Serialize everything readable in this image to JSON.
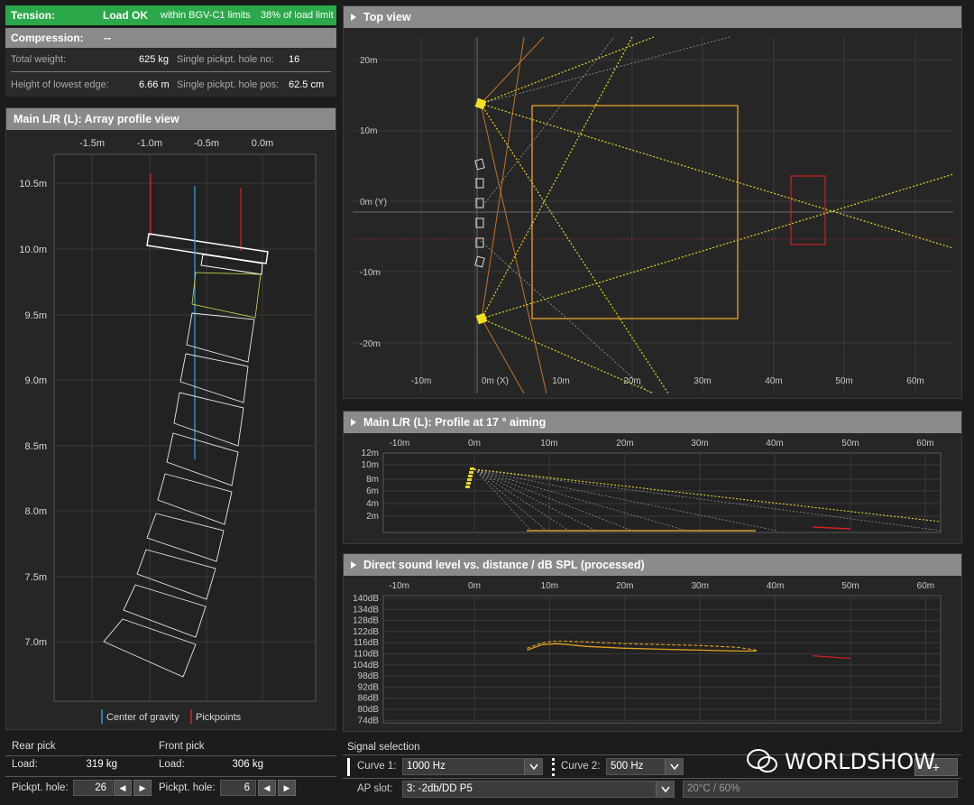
{
  "status": {
    "tension_label": "Tension:",
    "tension_state": "Load OK",
    "tension_limit_text": "within BGV-C1 limits",
    "tension_percent_text": "38% of load limit",
    "compression_label": "Compression:",
    "compression_value": "--",
    "total_weight_label": "Total weight:",
    "total_weight_value": "625 kg",
    "pickpt_hole_no_label": "Single pickpt. hole no:",
    "pickpt_hole_no_value": "16",
    "lowest_edge_label": "Height of lowest edge:",
    "lowest_edge_value": "6.66 m",
    "pickpt_hole_pos_label": "Single pickpt. hole pos:",
    "pickpt_hole_pos_value": "62.5 cm",
    "ok_color": "#2aa84a"
  },
  "array_profile": {
    "title": "Main L/R (L): Array profile view",
    "x_ticks": [
      "-1.5m",
      "-1.0m",
      "-0.5m",
      "0.0m"
    ],
    "y_ticks": [
      "10.5m",
      "10.0m",
      "9.5m",
      "9.0m",
      "8.5m",
      "8.0m",
      "7.5m",
      "7.0m"
    ],
    "legend_cog": "Center of gravity",
    "legend_pick": "Pickpoints",
    "cog_color": "#2b9fd8",
    "pick_color": "#e02020"
  },
  "top_view": {
    "title": "Top view",
    "y_ticks": [
      "20m",
      "10m",
      "0m (Y)",
      "-10m",
      "-20m"
    ],
    "x_ticks": [
      "-10m",
      "0m (X)",
      "10m",
      "20m",
      "30m",
      "40m",
      "50m",
      "60m"
    ]
  },
  "profile_aiming": {
    "title": "Main L/R (L): Profile at 17 ° aiming",
    "x_ticks": [
      "-10m",
      "0m",
      "10m",
      "20m",
      "30m",
      "40m",
      "50m",
      "60m"
    ],
    "y_ticks": [
      "12m",
      "10m",
      "8m",
      "6m",
      "4m",
      "2m"
    ]
  },
  "spl_chart": {
    "title": "Direct sound level vs. distance / dB SPL (processed)",
    "x_ticks": [
      "-10m",
      "0m",
      "10m",
      "20m",
      "30m",
      "40m",
      "50m",
      "60m"
    ],
    "y_ticks": [
      "140dB",
      "134dB",
      "128dB",
      "122dB",
      "116dB",
      "110dB",
      "104dB",
      "98dB",
      "92dB",
      "86dB",
      "80dB",
      "74dB"
    ]
  },
  "chart_data": [
    {
      "type": "line",
      "title": "Direct sound level vs. distance / dB SPL (processed)",
      "xlabel": "",
      "ylabel": "",
      "xlim": [
        -10,
        60
      ],
      "ylim": [
        74,
        140
      ],
      "series": [
        {
          "x": [
            7,
            9,
            11,
            15,
            20,
            25,
            30,
            35,
            37.5
          ],
          "y": [
            112,
            115,
            115.5,
            114,
            113,
            112.5,
            112,
            111.5,
            111.5
          ]
        },
        {
          "x": [
            7,
            9,
            11,
            15,
            20,
            25,
            30,
            35,
            37.5
          ],
          "y": [
            113,
            116,
            117,
            116.5,
            115.5,
            115,
            114.5,
            113.5,
            112
          ]
        },
        {
          "x": [
            45,
            50
          ],
          "y": [
            109,
            107.5
          ]
        }
      ]
    }
  ],
  "rear_pick": {
    "title": "Rear pick",
    "load_label": "Load:",
    "load_value": "319 kg",
    "hole_label": "Pickpt. hole:",
    "hole_value": "26"
  },
  "front_pick": {
    "title": "Front pick",
    "load_label": "Load:",
    "load_value": "306 kg",
    "hole_label": "Pickpt. hole:",
    "hole_value": "6"
  },
  "signal": {
    "title": "Signal selection",
    "curve1_label": "Curve 1:",
    "curve1_value": "1000 Hz",
    "curve2_label": "Curve 2:",
    "curve2_value": "500 Hz",
    "ap_slot_label": "AP slot:",
    "ap_slot_value": "3: -2db/DD  P5",
    "climate_value": "20°C / 60%"
  },
  "watermark": "WORLDSHOW"
}
